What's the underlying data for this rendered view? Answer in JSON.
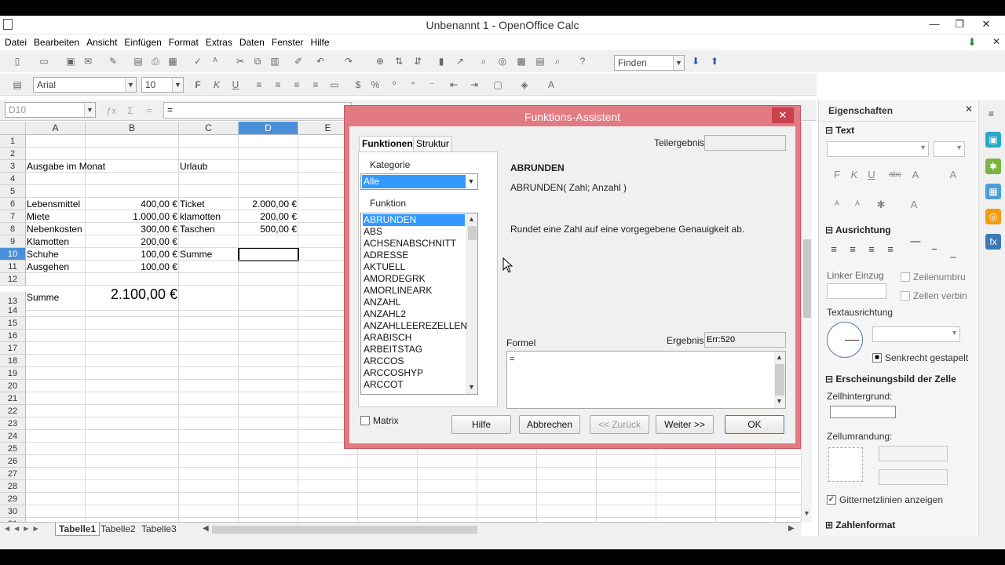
{
  "window": {
    "title": "Unbenannt 1 - OpenOffice Calc"
  },
  "menu": [
    "Datei",
    "Bearbeiten",
    "Ansicht",
    "Einfügen",
    "Format",
    "Extras",
    "Daten",
    "Fenster",
    "Hilfe"
  ],
  "toolbar": {
    "find_placeholder": "Finden",
    "font_name": "Arial",
    "font_size": "10"
  },
  "formula_bar": {
    "name_box": "D10",
    "content": "="
  },
  "grid": {
    "columns": [
      "A",
      "B",
      "C",
      "D",
      "E"
    ],
    "rows": [
      "1",
      "2",
      "3",
      "4",
      "5",
      "6",
      "7",
      "8",
      "9",
      "10",
      "11",
      "12",
      "13",
      "14",
      "15",
      "16",
      "17",
      "18",
      "19",
      "20",
      "21",
      "22",
      "23",
      "24",
      "25",
      "26",
      "27",
      "28",
      "29",
      "30",
      "31"
    ],
    "cells": {
      "A3": "Ausgabe im Monat",
      "C3": "Urlaub",
      "A6": "Lebensmittel",
      "B6": "400,00 €",
      "C6": "Ticket",
      "D6": "2.000,00 €",
      "A7": "Miete",
      "B7": "1.000,00 €",
      "C7": "klamotten",
      "D7": "200,00 €",
      "A8": "Nebenkosten",
      "B8": "300,00 €",
      "C8": "Taschen",
      "D8": "500,00 €",
      "A9": "Klamotten",
      "B9": "200,00 €",
      "A10": "Schuhe",
      "B10": "100,00 €",
      "C10": "Summe",
      "A11": "Ausgehen",
      "B11": "100,00 €",
      "A13": "Summe",
      "B13": "2.100,00 €"
    }
  },
  "sheets": [
    "Tabelle1",
    "Tabelle2",
    "Tabelle3"
  ],
  "dialog": {
    "title": "Funktions-Assistent",
    "tabs": [
      "Funktionen",
      "Struktur"
    ],
    "category_label": "Kategorie",
    "category_value": "Alle",
    "function_label": "Funktion",
    "functions": [
      "ABRUNDEN",
      "ABS",
      "ACHSENABSCHNITT",
      "ADRESSE",
      "AKTUELL",
      "AMORDEGRK",
      "AMORLINEARK",
      "ANZAHL",
      "ANZAHL2",
      "ANZAHLLEEREZELLEN",
      "ARABISCH",
      "ARBEITSTAG",
      "ARCCOS",
      "ARCCOSHYP",
      "ARCCOT"
    ],
    "teilergebnis_label": "Teilergebnis",
    "func_name": "ABRUNDEN",
    "func_syntax": "ABRUNDEN( Zahl; Anzahl )",
    "func_desc": "Rundet eine Zahl auf eine vorgegebene Genauigkeit ab.",
    "formel_label": "Formel",
    "ergebnis_label": "Ergebnis",
    "ergebnis_value": "Err:520",
    "formel_value": "=",
    "matrix_label": "Matrix",
    "buttons": {
      "help": "Hilfe",
      "cancel": "Abbrechen",
      "back": "<< Zurück",
      "next": "Weiter >>",
      "ok": "OK"
    }
  },
  "sidebar": {
    "title": "Eigenschaften",
    "text_section": "Text",
    "align_section": "Ausrichtung",
    "indent_label": "Linker Einzug",
    "wrap_label": "Zeilenumbru",
    "merge_label": "Zellen verbin",
    "textdir_label": "Textausrichtung",
    "stacked_label": "Senkrecht gestapelt",
    "cell_appearance_section": "Erscheinungsbild der Zelle",
    "bg_label": "Zellhintergrund:",
    "border_label": "Zellumrandung:",
    "gridlines_label": "Gitternetzlinien anzeigen",
    "number_format_section": "Zahlenformat"
  }
}
